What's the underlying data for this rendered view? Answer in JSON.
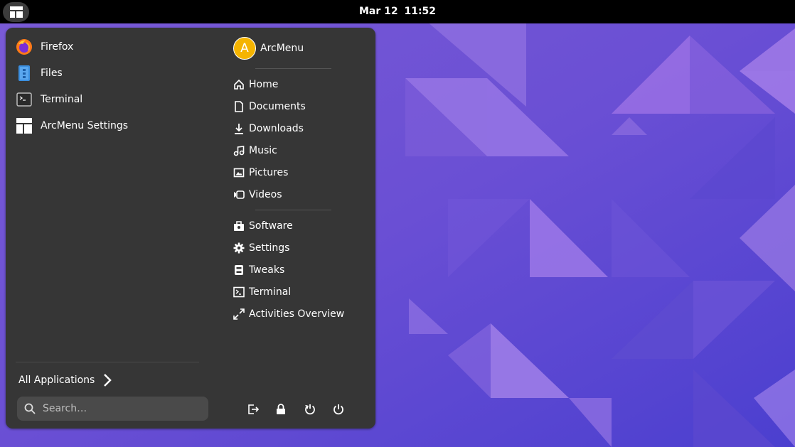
{
  "topbar": {
    "date": "Mar 12",
    "time": "11:52",
    "menu_button_icon": "arcmenu-layout-icon"
  },
  "menu": {
    "favorites": [
      {
        "label": "Firefox",
        "icon": "firefox-icon"
      },
      {
        "label": "Files",
        "icon": "files-icon"
      },
      {
        "label": "Terminal",
        "icon": "terminal-app-icon"
      },
      {
        "label": "ArcMenu Settings",
        "icon": "arcmenu-settings-icon"
      }
    ],
    "all_apps_label": "All Applications",
    "search": {
      "placeholder": "Search…",
      "value": ""
    },
    "user": {
      "name": "ArcMenu",
      "avatar_letter": "A",
      "avatar_color": "#f5b400"
    },
    "places": [
      {
        "label": "Home",
        "icon": "home-icon"
      },
      {
        "label": "Documents",
        "icon": "document-icon"
      },
      {
        "label": "Downloads",
        "icon": "download-icon"
      },
      {
        "label": "Music",
        "icon": "music-icon"
      },
      {
        "label": "Pictures",
        "icon": "picture-icon"
      },
      {
        "label": "Videos",
        "icon": "video-icon"
      }
    ],
    "system": [
      {
        "label": "Software",
        "icon": "software-icon"
      },
      {
        "label": "Settings",
        "icon": "settings-icon"
      },
      {
        "label": "Tweaks",
        "icon": "tweaks-icon"
      },
      {
        "label": "Terminal",
        "icon": "terminal-icon"
      },
      {
        "label": "Activities Overview",
        "icon": "activities-icon"
      }
    ],
    "session_buttons": [
      "log-out-icon",
      "lock-icon",
      "restart-icon",
      "power-icon"
    ]
  },
  "colors": {
    "menu_bg": "#363636",
    "topbar_bg": "#000000",
    "wallpaper_base": "#5b45c9",
    "accent": "#f5b400"
  }
}
